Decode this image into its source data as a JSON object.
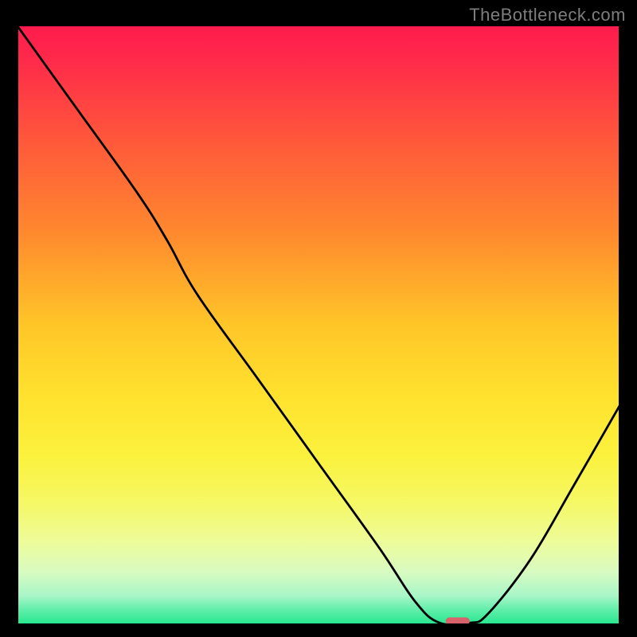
{
  "watermark": "TheBottleneck.com",
  "chart_data": {
    "type": "line",
    "title": "",
    "xlabel": "",
    "ylabel": "",
    "xlim": [
      0,
      100
    ],
    "ylim": [
      0,
      100
    ],
    "background_gradient": {
      "stops": [
        {
          "pos": 0.0,
          "color": "#ff1a4d"
        },
        {
          "pos": 0.06,
          "color": "#ff2a4a"
        },
        {
          "pos": 0.2,
          "color": "#ff5a3a"
        },
        {
          "pos": 0.35,
          "color": "#ff8a2e"
        },
        {
          "pos": 0.5,
          "color": "#ffc628"
        },
        {
          "pos": 0.62,
          "color": "#ffe22e"
        },
        {
          "pos": 0.72,
          "color": "#fbf23e"
        },
        {
          "pos": 0.8,
          "color": "#f5f868"
        },
        {
          "pos": 0.86,
          "color": "#eefc9a"
        },
        {
          "pos": 0.91,
          "color": "#d8fbc0"
        },
        {
          "pos": 0.95,
          "color": "#a8f6c8"
        },
        {
          "pos": 0.975,
          "color": "#5ceea8"
        },
        {
          "pos": 1.0,
          "color": "#1fe68c"
        }
      ]
    },
    "curve": {
      "name": "bottleneck-curve",
      "color": "#000000",
      "points": [
        {
          "x": 0.0,
          "y": 100.0
        },
        {
          "x": 10.0,
          "y": 86.0
        },
        {
          "x": 20.0,
          "y": 72.0
        },
        {
          "x": 25.0,
          "y": 64.0
        },
        {
          "x": 30.0,
          "y": 55.0
        },
        {
          "x": 40.0,
          "y": 41.0
        },
        {
          "x": 50.0,
          "y": 27.0
        },
        {
          "x": 60.0,
          "y": 13.0
        },
        {
          "x": 66.0,
          "y": 4.0
        },
        {
          "x": 70.0,
          "y": 0.5
        },
        {
          "x": 75.0,
          "y": 0.5
        },
        {
          "x": 78.0,
          "y": 2.0
        },
        {
          "x": 85.0,
          "y": 11.0
        },
        {
          "x": 92.0,
          "y": 23.0
        },
        {
          "x": 100.0,
          "y": 37.0
        }
      ]
    },
    "marker": {
      "name": "optimal-marker",
      "x": 73.0,
      "y": 0.8,
      "color": "#d9636b",
      "width": 4.0,
      "height": 1.2
    }
  }
}
